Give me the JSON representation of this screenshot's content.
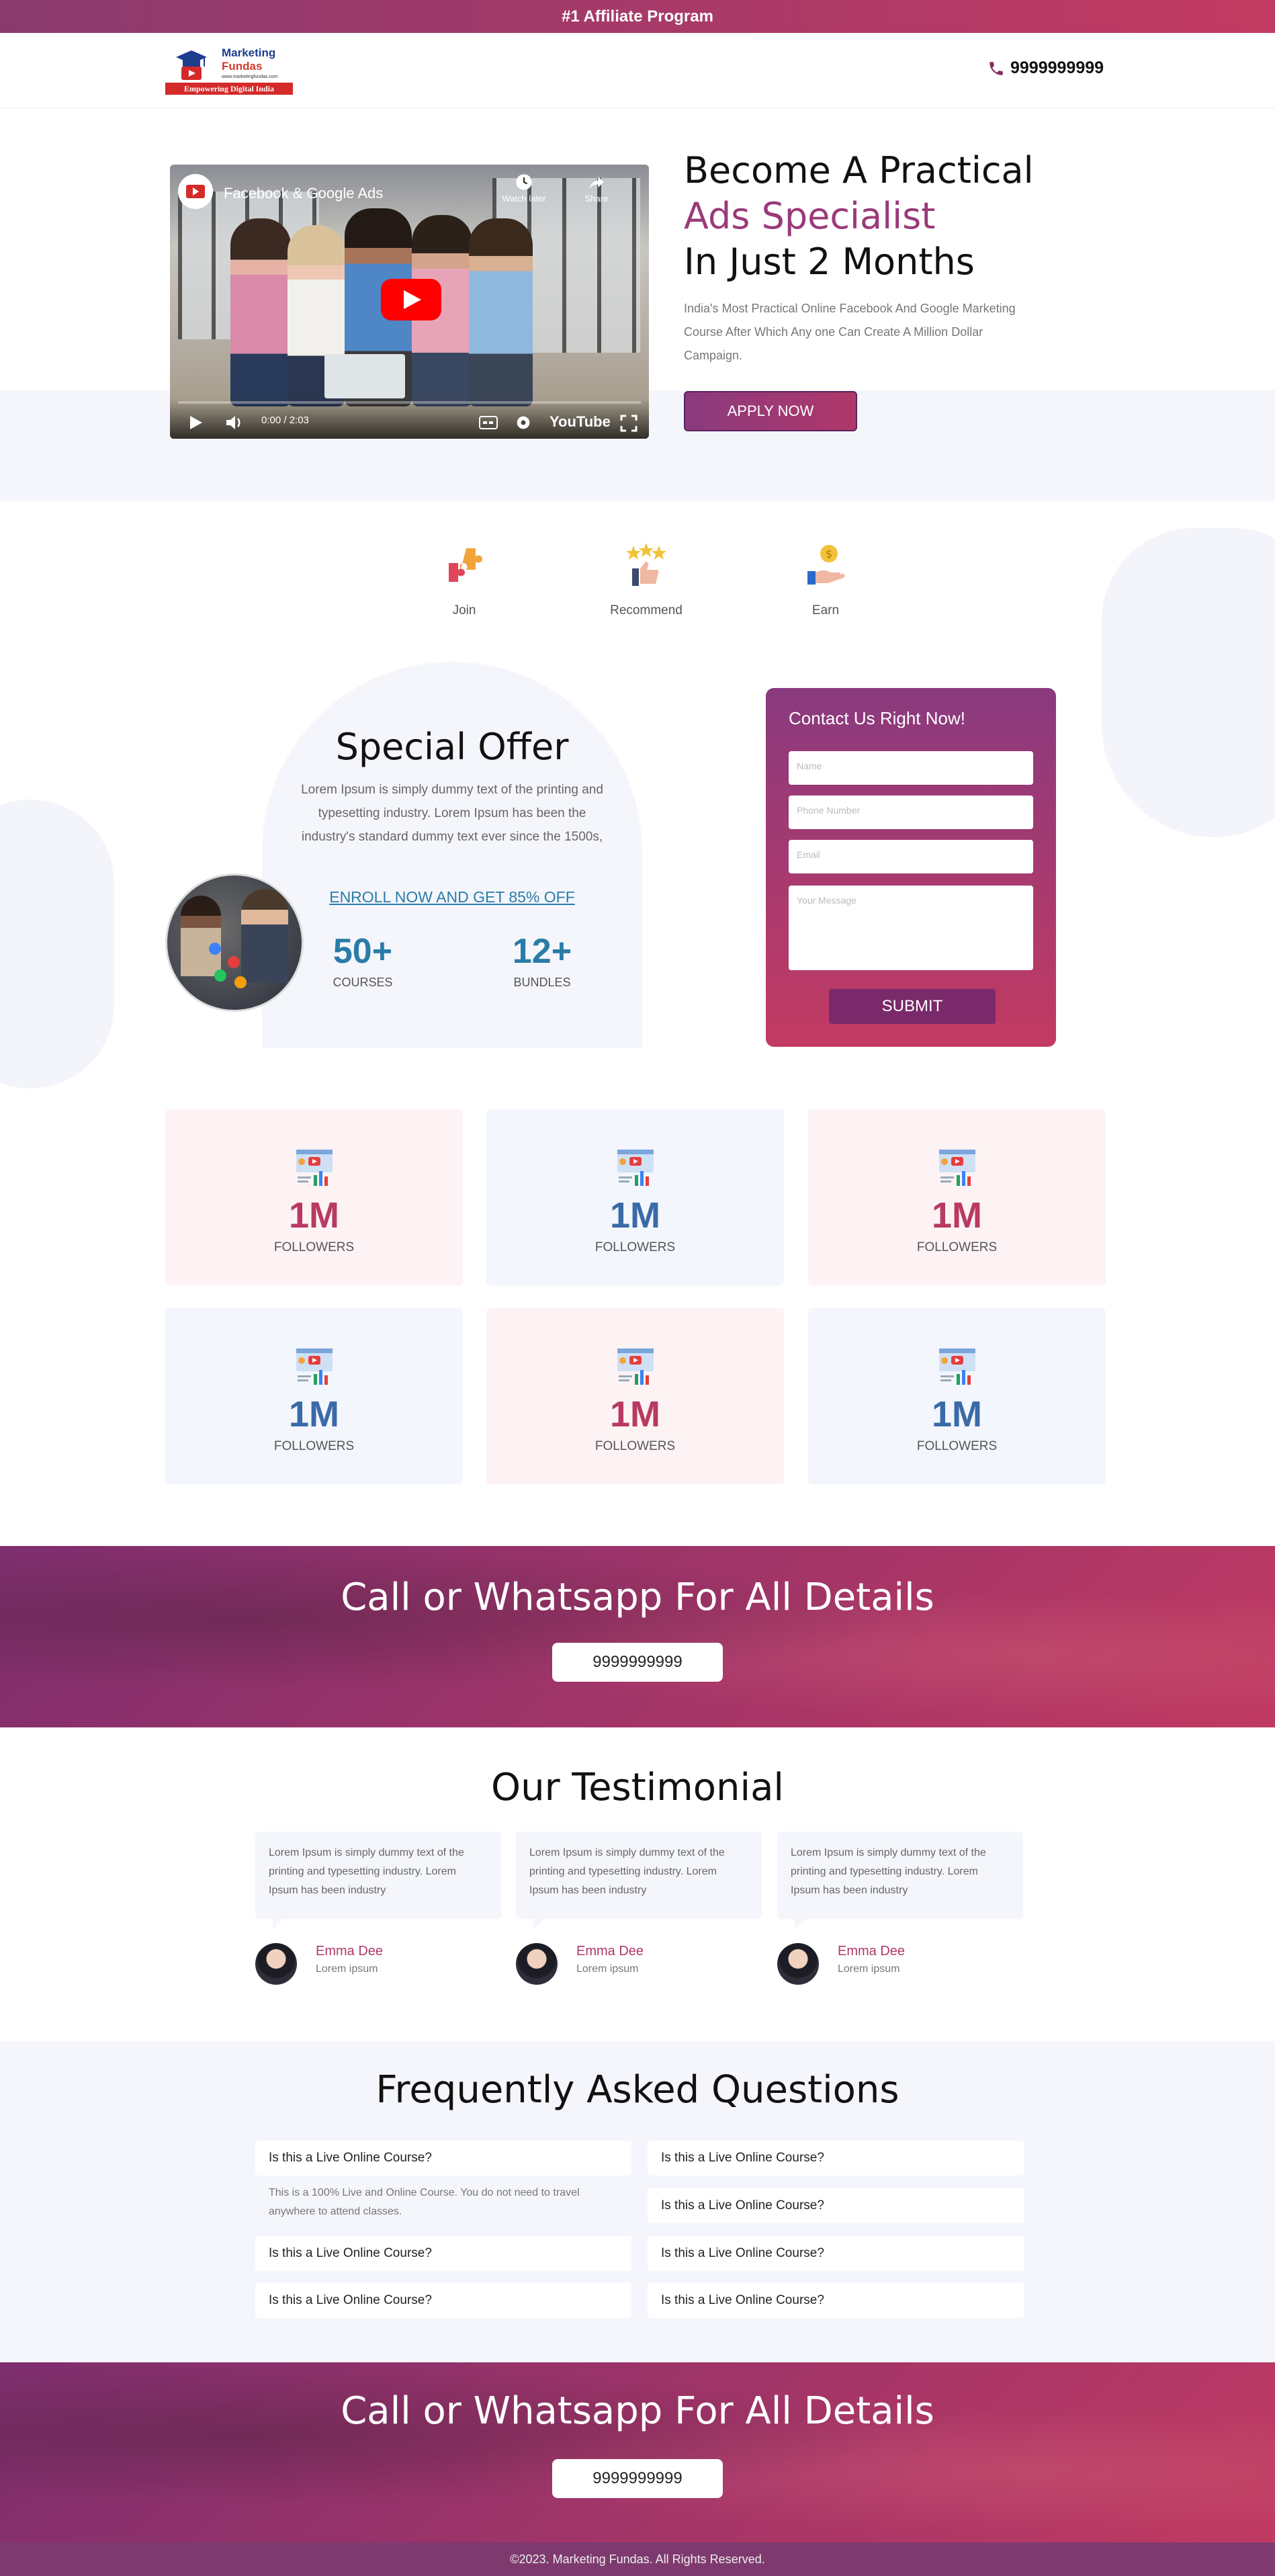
{
  "topbar": {
    "text": "#1 Affiliate Program"
  },
  "header": {
    "logo": {
      "line1": "Marketing",
      "line2": "Fundas",
      "url": "www.marketingfundas.com",
      "tagline": "Empowering Digital India"
    },
    "phone": "9999999999"
  },
  "hero": {
    "video": {
      "title": "Facebook & Google Ads",
      "watch_later": "Watch later",
      "share": "Share",
      "time": "0:00 / 2:03",
      "brand": "YouTube"
    },
    "title_line1": "Become A Practical",
    "title_line2": "Ads Specialist",
    "title_line3": "In Just 2 Months",
    "subtitle": "India's Most Practical Online Facebook And Google Marketing Course After Which Any one Can Create A Million Dollar Campaign.",
    "cta": "APPLY NOW"
  },
  "steps": [
    {
      "label": "Join",
      "icon": "puzzle-icon"
    },
    {
      "label": "Recommend",
      "icon": "thumbs-up-stars-icon"
    },
    {
      "label": "Earn",
      "icon": "hand-coin-icon"
    }
  ],
  "offer": {
    "title": "Special Offer",
    "text": "Lorem Ipsum is simply dummy text of the printing and typesetting industry. Lorem Ipsum has been the industry's standard dummy text ever since the 1500s,",
    "link": "ENROLL NOW AND GET 85% OFF",
    "stats": [
      {
        "value": "50+",
        "label": "COURSES"
      },
      {
        "value": "12+",
        "label": "BUNDLES"
      }
    ]
  },
  "form": {
    "title": "Contact Us Right Now!",
    "name_placeholder": "Name",
    "phone_placeholder": "Phone Number",
    "email_placeholder": "Email",
    "message_placeholder": "Your Message",
    "submit": "SUBMIT"
  },
  "stats_cards": [
    {
      "value": "1M",
      "label": "FOLLOWERS",
      "tone": "pink"
    },
    {
      "value": "1M",
      "label": "FOLLOWERS",
      "tone": "blue"
    },
    {
      "value": "1M",
      "label": "FOLLOWERS",
      "tone": "pink"
    },
    {
      "value": "1M",
      "label": "FOLLOWERS",
      "tone": "blue"
    },
    {
      "value": "1M",
      "label": "FOLLOWERS",
      "tone": "pink"
    },
    {
      "value": "1M",
      "label": "FOLLOWERS",
      "tone": "blue"
    }
  ],
  "cta1": {
    "title": "Call or Whatsapp For All Details",
    "button": "9999999999"
  },
  "testimonials": {
    "title": "Our Testimonial",
    "items": [
      {
        "text": "Lorem Ipsum is simply dummy text of the printing and typesetting industry. Lorem Ipsum has been industry",
        "name": "Emma Dee",
        "role": "Lorem ipsum"
      },
      {
        "text": "Lorem Ipsum is simply dummy text of the printing and typesetting industry. Lorem Ipsum has been industry",
        "name": "Emma Dee",
        "role": "Lorem ipsum"
      },
      {
        "text": "Lorem Ipsum is simply dummy text of the printing and typesetting industry. Lorem Ipsum has been industry",
        "name": "Emma Dee",
        "role": "Lorem ipsum"
      }
    ]
  },
  "faq": {
    "title": "Frequently Asked Questions",
    "left": [
      {
        "q": "Is this a Live Online Course?",
        "a": "This is a 100% Live and Online Course. You do not need to travel anywhere to attend classes."
      },
      {
        "q": "Is this a Live Online Course?",
        "a": ""
      },
      {
        "q": "Is this a Live Online Course?",
        "a": ""
      }
    ],
    "right": [
      {
        "q": "Is this a Live Online Course?"
      },
      {
        "q": "Is this a Live Online Course?"
      },
      {
        "q": "Is this a Live Online Course?"
      },
      {
        "q": "Is this a Live Online Course?"
      }
    ]
  },
  "cta2": {
    "title": "Call or Whatsapp For All Details",
    "button": "9999999999"
  },
  "footer": {
    "text": "©2023. Marketing Fundas. All Rights Reserved."
  },
  "colors": {
    "brand_purple": "#8a3a7e",
    "brand_pink": "#c23a62",
    "accent_blue": "#2a7ca8"
  }
}
